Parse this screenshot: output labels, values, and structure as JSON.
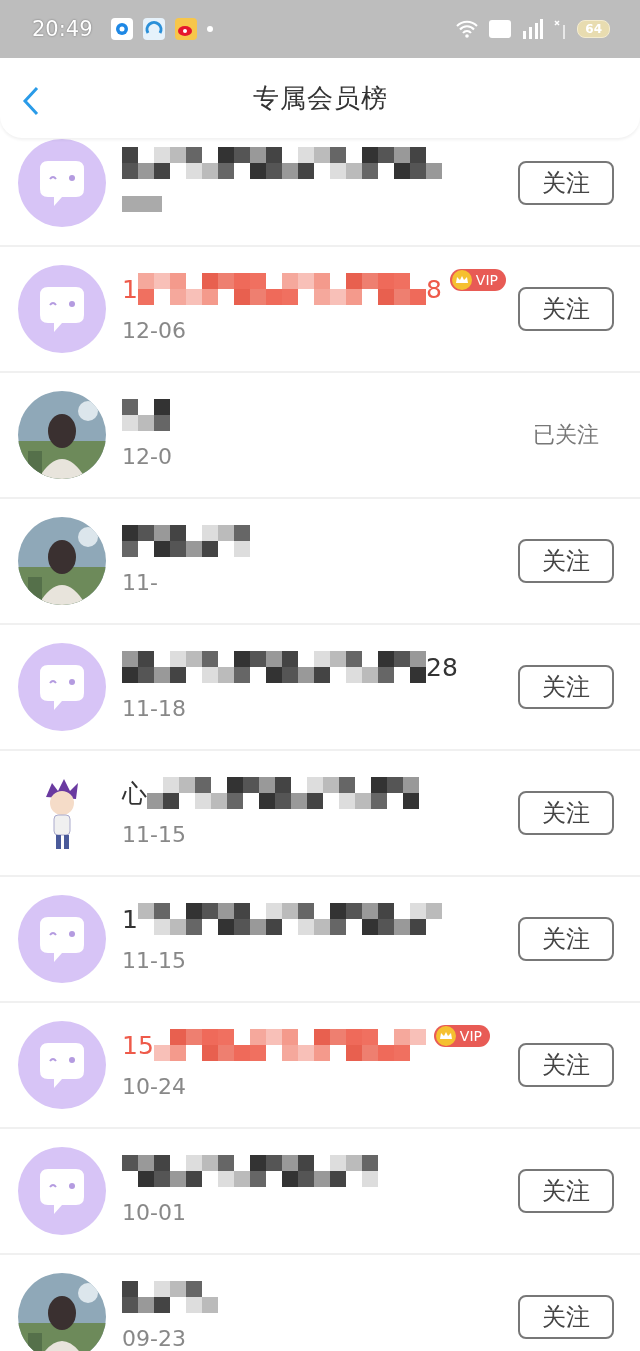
{
  "status_bar": {
    "time": "20:49",
    "battery": "64"
  },
  "header": {
    "title": "专属会员榜"
  },
  "rows": [
    {
      "avatar": {
        "kind": "default"
      },
      "name_start": "",
      "name_end": "",
      "vip": false,
      "date": "",
      "followed": false,
      "action": "关注"
    },
    {
      "avatar": {
        "kind": "default"
      },
      "name_start": "1",
      "name_end": "8",
      "vip": true,
      "vip_label": "VIP",
      "date": "12-06",
      "followed": false,
      "action": "关注"
    },
    {
      "name_start": "",
      "name_end": "",
      "vip": false,
      "date": "12-0",
      "followed": true,
      "action": "已关注"
    },
    {
      "name_start": "",
      "name_end": "",
      "vip": false,
      "date": "11-",
      "followed": false,
      "action": "关注"
    },
    {
      "avatar": {
        "kind": "default"
      },
      "name_start": "",
      "name_end": "28",
      "vip": false,
      "date": "11-18",
      "followed": false,
      "action": "关注"
    },
    {
      "avatar": {
        "kind": "character"
      },
      "name_start": "心",
      "name_end": "",
      "vip": false,
      "date": "11-15",
      "followed": false,
      "action": "关注"
    },
    {
      "avatar": {
        "kind": "default"
      },
      "name_start": "1",
      "name_end": "",
      "vip": false,
      "date": "11-15",
      "followed": false,
      "action": "关注"
    },
    {
      "avatar": {
        "kind": "default"
      },
      "name_start": "15",
      "name_end": "",
      "vip": true,
      "vip_label": "VIP",
      "date": "10-24",
      "followed": false,
      "action": "关注"
    },
    {
      "avatar": {
        "kind": "default"
      },
      "name_start": "",
      "name_end": "",
      "vip": false,
      "date": "10-01",
      "followed": false,
      "action": "关注"
    },
    {
      "name_start": "",
      "name_end": "",
      "vip": false,
      "date": "09-23",
      "followed": false,
      "action": "关注"
    }
  ]
}
